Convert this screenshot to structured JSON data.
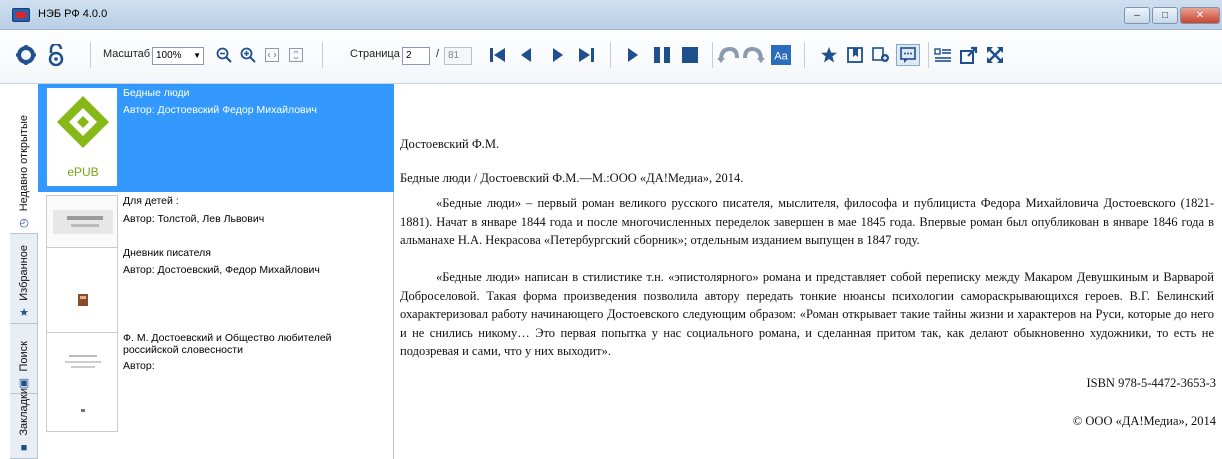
{
  "window": {
    "title": "НЭБ РФ 4.0.0"
  },
  "toolbar": {
    "zoom_label": "Масштаб",
    "zoom_value": "100%",
    "page_label": "Страница",
    "page_current": "2",
    "page_total": "81",
    "page_separator": "/"
  },
  "tabs": [
    {
      "label": "Недавно открытые"
    },
    {
      "label": "Избранное"
    },
    {
      "label": "Поиск"
    },
    {
      "label": "Закладки"
    }
  ],
  "books": [
    {
      "title": "Бедные люди",
      "author": "Автор: Достоевский Федор Михайлович",
      "cover_text": "ePUB"
    },
    {
      "title": "Для детей :",
      "author": "Автор: Толстой, Лев Львович"
    },
    {
      "title": "Дневник писателя",
      "author": "Автор: Достоевский, Федор Михайлович"
    },
    {
      "title": "Ф. М. Достоевский и Общество любителей российской словесности",
      "author": "Автор:"
    }
  ],
  "reader": {
    "author": "Достоевский Ф.М.",
    "bibliography": "Бедные люди / Достоевский Ф.М.—М.:ООО «ДА!Медиа», 2014.",
    "paragraph1": "«Бедные люди» – первый роман великого русского писателя, мыслителя, философа и публициста Федора Михайловича Достоевского (1821-1881). Начат в январе 1844 года и после многочисленных переделок завершен в мае 1845 года. Впервые роман был опубликован в январе 1846 года в альманахе Н.А. Некрасова «Петербургский сборник»; отдельным изданием выпущен в 1847 году.",
    "paragraph2": "«Бедные люди» написан в стилистике т.н. «эпистолярного» романа и представляет собой переписку между Макаром Девушкиным и Варварой Доброселовой. Такая форма произведения позволила автору передать тонкие нюансы психологии самораскрывающихся героев. В.Г. Белинский охарактеризовал работу начинающего Достоевского следующим образом: «Роман открывает такие тайны жизни и характеров на Руси, которые до него и не снились никому… Это первая попытка у нас социального романа, и сделанная притом так, как делают обыкновенно художники, то есть не подозревая и сами, что у них выходит».",
    "isbn": "ISBN 978-5-4472-3653-3",
    "copyright": "© ООО «ДА!Медиа», 2014"
  },
  "colors": {
    "accent": "#3399ff",
    "toolbar_icon": "#1f4f8c"
  }
}
